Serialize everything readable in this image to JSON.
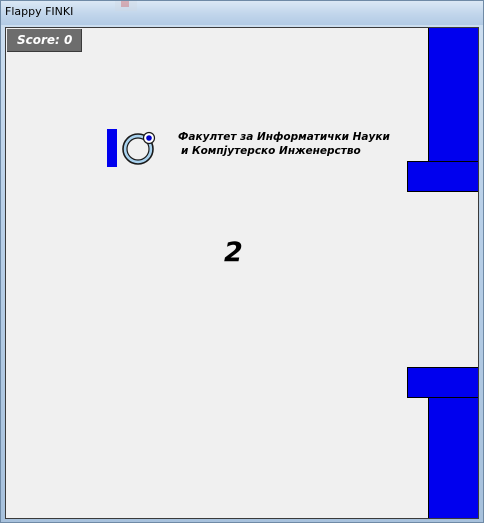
{
  "window": {
    "title": "Flappy FINKI"
  },
  "game": {
    "score_label": "Score: 0",
    "counter": "2",
    "logo": {
      "line1": "Факултет за Информатички Науки",
      "line2": "и  Компјутерско Инженерство"
    }
  },
  "colors": {
    "pipe": "#0000ee",
    "background": "#f0f0f0",
    "score_box": "#6d6d6d",
    "logo_ring": "#a9d2ee"
  }
}
